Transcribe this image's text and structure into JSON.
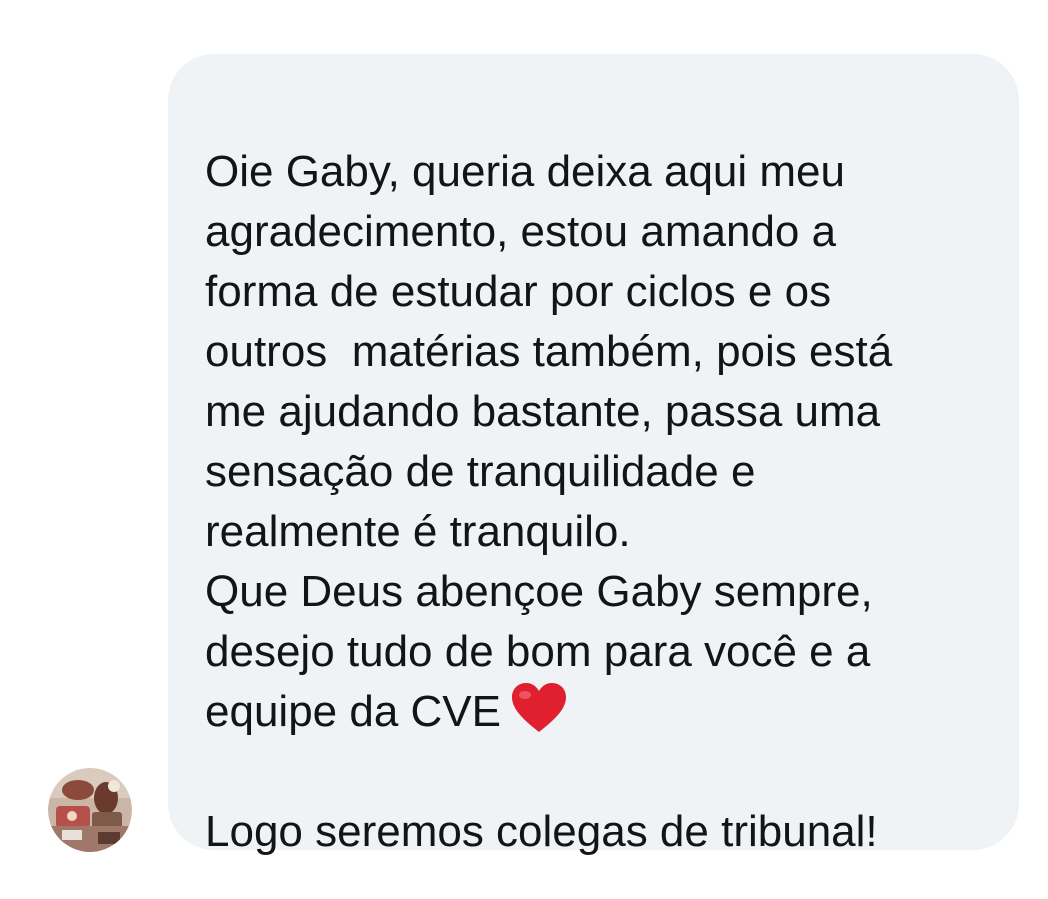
{
  "message": {
    "lines": [
      "Oie Gaby, queria deixa aqui meu",
      "agradecimento, estou amando a",
      "forma de estudar por ciclos e os",
      "outros  matérias também, pois está",
      "me ajudando bastante, passa uma",
      "sensação de tranquilidade e",
      "realmente é tranquilo.",
      "Que Deus abençoe Gaby sempre,",
      "desejo tudo de bom para você e a",
      "equipe da CVE",
      "",
      "Logo seremos colegas de tribunal!"
    ],
    "emoji": "heart-emoji",
    "bubble_color": "#eff3f5",
    "text_color": "#141414",
    "heart_color": "#e0202e"
  },
  "sender": {
    "avatar": "avatar-photo"
  }
}
